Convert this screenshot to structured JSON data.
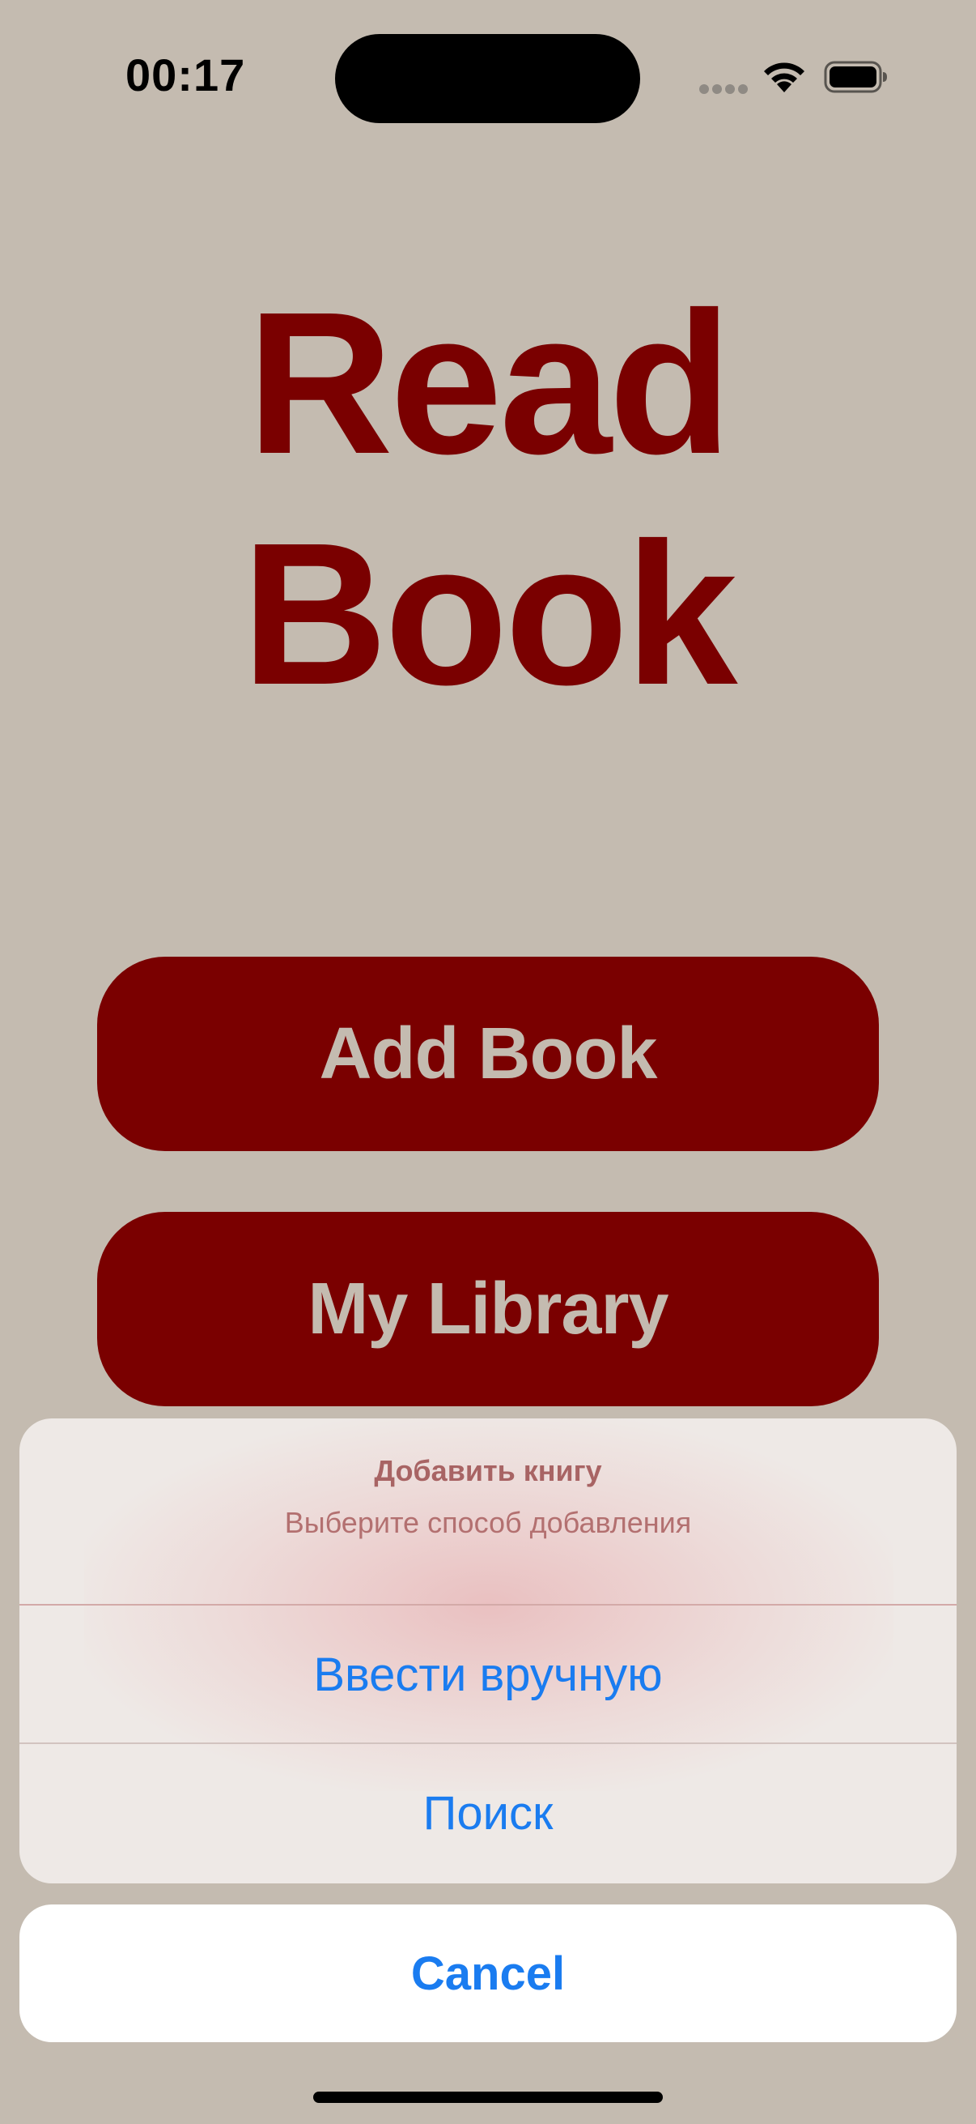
{
  "status_bar": {
    "time": "00:17",
    "icons": [
      "signal-icon",
      "wifi-icon",
      "battery-icon"
    ]
  },
  "app": {
    "title_line1": "Read",
    "title_line2": "Book",
    "add_book_label": "Add Book",
    "my_library_label": "My Library"
  },
  "action_sheet": {
    "title": "Добавить книгу",
    "subtitle": "Выберите способ добавления",
    "actions": [
      {
        "label": "Ввести вручную"
      },
      {
        "label": "Поиск"
      }
    ],
    "cancel_label": "Cancel"
  },
  "colors": {
    "background": "#c4bbb0",
    "brand": "#7a0000",
    "action_blue": "#1a7cf0"
  }
}
